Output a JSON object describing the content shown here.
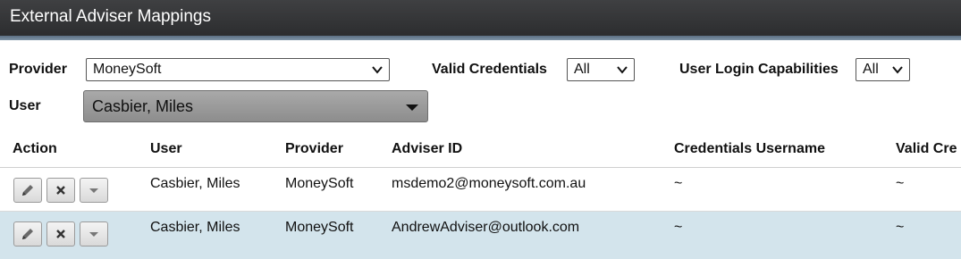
{
  "header": {
    "title": "External Adviser Mappings"
  },
  "filters": {
    "provider_label": "Provider",
    "provider_value": "MoneySoft",
    "valid_credentials_label": "Valid Credentials",
    "valid_credentials_value": "All",
    "user_login_label": "User Login Capabilities",
    "user_login_value": "All",
    "user_label": "User",
    "user_value": "Casbier, Miles"
  },
  "table": {
    "columns": [
      "Action",
      "User",
      "Provider",
      "Adviser ID",
      "Credentials Username",
      "Valid Cre"
    ],
    "rows": [
      {
        "user": "Casbier, Miles",
        "provider": "MoneySoft",
        "adviser_id": "msdemo2@moneysoft.com.au",
        "credentials_username": "~",
        "valid_credentials": "~"
      },
      {
        "user": "Casbier, Miles",
        "provider": "MoneySoft",
        "adviser_id": "AndrewAdviser@outlook.com",
        "credentials_username": "~",
        "valid_credentials": "~"
      }
    ],
    "action_icons": [
      "pencil-icon",
      "x-icon",
      "caret-down-icon"
    ]
  },
  "colors": {
    "titlebar": "#2f3032",
    "title_rule": "#6b8094",
    "row_alt": "#d3e4ec"
  }
}
